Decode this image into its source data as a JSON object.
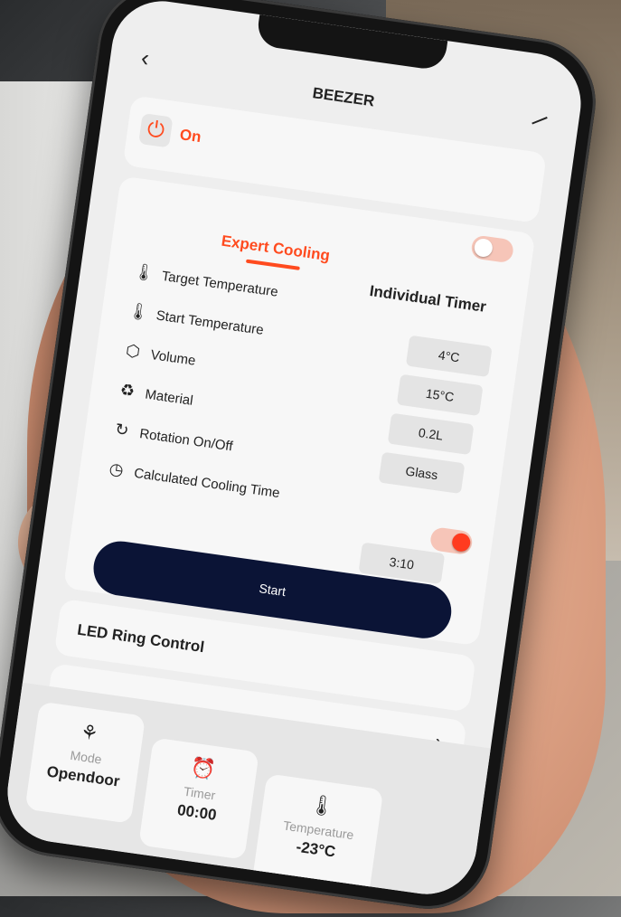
{
  "header": {
    "title": "BEEZER"
  },
  "power": {
    "label": "On",
    "on": true
  },
  "tabs": {
    "active": "Expert Cooling",
    "other": "Individual Timer"
  },
  "settings": [
    {
      "label": "Target Temperature",
      "icon": "thermometer-icon"
    },
    {
      "label": "Start Temperature",
      "icon": "thermometer-down-icon",
      "value": "4°C"
    },
    {
      "label": "Volume",
      "icon": "cube-icon",
      "value": "15°C"
    },
    {
      "label": "Material",
      "icon": "recycle-icon",
      "value": "0.2L"
    },
    {
      "label": "Rotation On/Off",
      "icon": "rotate-icon",
      "value": "Glass"
    },
    {
      "label": "Calculated Cooling Time",
      "icon": "clock-icon",
      "value": "3:10"
    }
  ],
  "start_button": {
    "label": "Start"
  },
  "led": {
    "label": "LED Ring Control"
  },
  "bottom": {
    "mode": {
      "label": "Mode",
      "value": "Opendoor",
      "icon": "grid-icon"
    },
    "timer": {
      "label": "Timer",
      "value": "00:00",
      "icon": "alarm-icon"
    },
    "temperature": {
      "label": "Temperature",
      "value": "-23°C",
      "icon": "thermometer-icon"
    }
  },
  "colors": {
    "accent": "#ff4b1f",
    "start_button": "#0b1436"
  }
}
